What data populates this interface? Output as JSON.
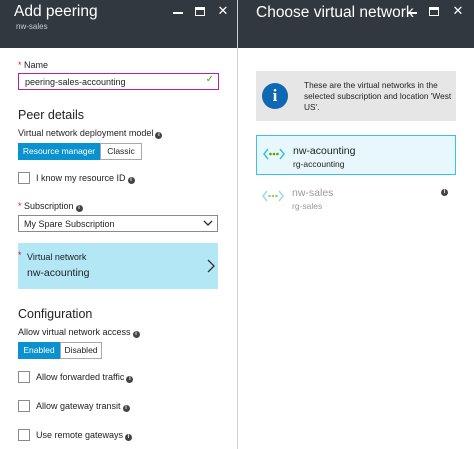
{
  "left_blade": {
    "title": "Add peering",
    "subtitle": "nw-sales",
    "name_field": {
      "label": "Name",
      "value": "peering-sales-accounting"
    },
    "peer_details_heading": "Peer details",
    "deployment_model": {
      "label": "Virtual network deployment model",
      "options": [
        "Resource manager",
        "Classic"
      ],
      "selected": "Resource manager"
    },
    "resource_id_checkbox": {
      "label": "I know my resource ID",
      "checked": false
    },
    "subscription": {
      "label": "Subscription",
      "value": "My Spare Subscription"
    },
    "virtual_network": {
      "label": "Virtual network",
      "value": "nw-acounting"
    },
    "configuration_heading": "Configuration",
    "allow_access": {
      "label": "Allow virtual network access",
      "options": [
        "Enabled",
        "Disabled"
      ],
      "selected": "Enabled"
    },
    "checkboxes": [
      {
        "label": "Allow forwarded traffic",
        "checked": false
      },
      {
        "label": "Allow gateway transit",
        "checked": false
      },
      {
        "label": "Use remote gateways",
        "checked": false
      }
    ]
  },
  "right_blade": {
    "title": "Choose virtual network",
    "info_text": "These are the virtual networks in the selected subscription and location 'West US'.",
    "networks": [
      {
        "name": "nw-acounting",
        "resource_group": "rg-accounting",
        "selected": true
      },
      {
        "name": "nw-sales",
        "resource_group": "rg-sales",
        "selected": false
      }
    ]
  },
  "colors": {
    "header_bg": "#32383f",
    "accent_blue": "#0a92d0",
    "selection_bg": "#b3e7f5",
    "required_red": "#e81123",
    "valid_green": "#57a300",
    "info_icon_blue": "#0f68b3",
    "vnet_icon_green": "#57a300",
    "vnet_icon_blue": "#3cc1e6"
  },
  "icons": {
    "minimize": "minimize-icon",
    "maximize": "maximize-icon",
    "close": "close-icon",
    "info": "info-icon",
    "valid": "checkmark-icon",
    "dropdown": "chevron-down-icon",
    "next": "chevron-right-icon",
    "vnet": "virtual-network-icon"
  }
}
